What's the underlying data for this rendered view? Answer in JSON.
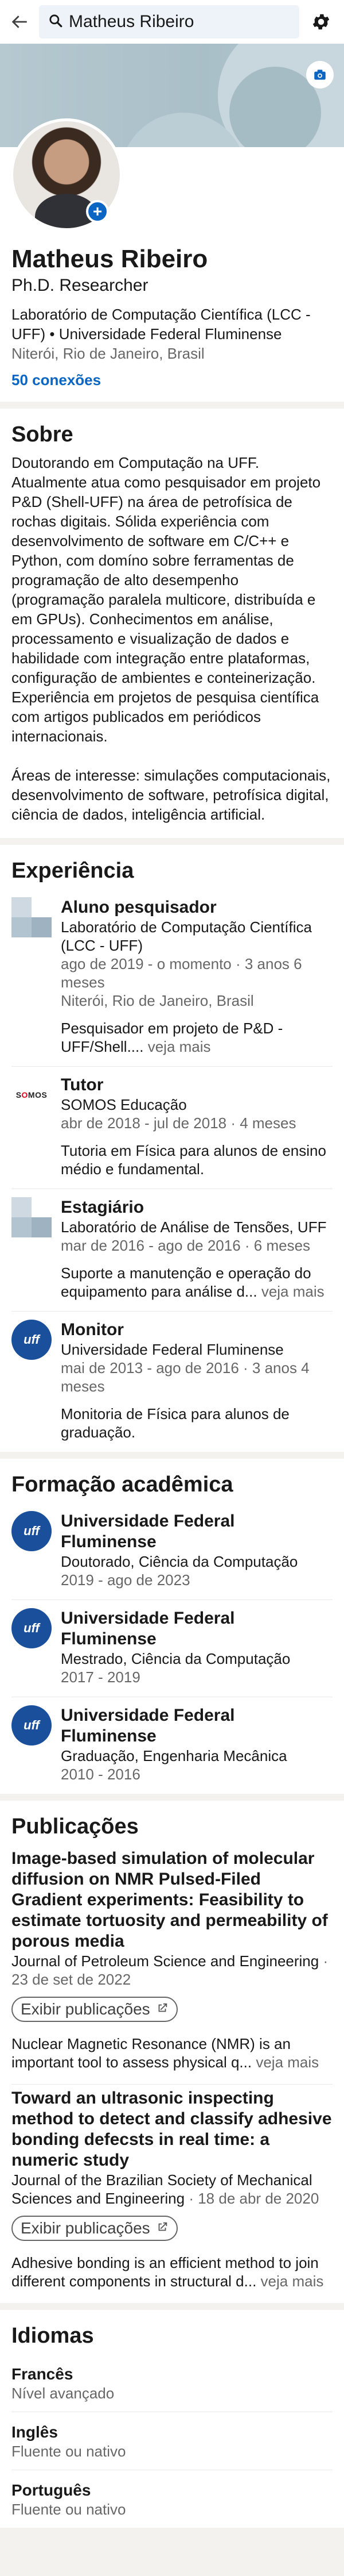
{
  "search": {
    "query": "Matheus Ribeiro"
  },
  "profile": {
    "name": "Matheus Ribeiro",
    "headline": "Ph.D. Researcher",
    "org": "Laboratório de Computação Científica  (LCC - UFF) • Universidade Federal Fluminense",
    "location": "Niterói, Rio de Janeiro, Brasil",
    "connections": "50 conexões"
  },
  "about": {
    "title": "Sobre",
    "paragraph1": "Doutorando em Computação na UFF. Atualmente atua como pesquisador em projeto P&D (Shell-UFF) na área de petrofísica de rochas digitais. Sólida experiência com desenvolvimento de software em C/C++ e Python, com domíno sobre ferramentas de programação de alto desempenho (programação paralela multicore, distribuída e em GPUs). Conhecimentos em análise, processamento e visualização de dados e habilidade com integração entre plataformas, configuração de ambientes e conteinerização. Experiência em projetos de pesquisa científica com artigos publicados em periódicos internacionais.",
    "paragraph2": "Áreas de interesse: simulações computacionais, desenvolvimento de software, petrofísica digital, ciência de dados, inteligência artificial."
  },
  "experience": {
    "title": "Experiência",
    "items": [
      {
        "title": "Aluno pesquisador",
        "org": "Laboratório de Computação Científica (LCC - UFF)",
        "dates": "ago de 2019 - o momento · 3 anos 6 meses",
        "location": "Niterói, Rio de Janeiro, Brasil",
        "desc": "Pesquisador em projeto de P&D - UFF/Shell....",
        "more": "veja mais"
      },
      {
        "title": "Tutor",
        "org": "SOMOS Educação",
        "dates": "abr de 2018 - jul de 2018 · 4 meses",
        "location": "",
        "desc": "Tutoria em Física para alunos de ensino médio e fundamental.",
        "more": ""
      },
      {
        "title": "Estagiário",
        "org": "Laboratório de Análise de Tensões, UFF",
        "dates": "mar de 2016 - ago de 2016 · 6 meses",
        "location": "",
        "desc": "Suporte a manutenção e operação do equipamento para análise d...",
        "more": "veja mais"
      },
      {
        "title": "Monitor",
        "org": "Universidade Federal Fluminense",
        "dates": "mai de 2013 - ago de 2016 · 3 anos 4 meses",
        "location": "",
        "desc": "Monitoria de Física para alunos de graduação.",
        "more": ""
      }
    ]
  },
  "education": {
    "title": "Formação acadêmica",
    "items": [
      {
        "school": "Universidade Federal Fluminense",
        "degree": "Doutorado, Ciência da Computação",
        "dates": "2019 - ago de 2023"
      },
      {
        "school": "Universidade Federal Fluminense",
        "degree": "Mestrado, Ciência da Computação",
        "dates": "2017 - 2019"
      },
      {
        "school": "Universidade Federal Fluminense",
        "degree": "Graduação, Engenharia Mecânica",
        "dates": "2010 - 2016"
      }
    ]
  },
  "publications": {
    "title": "Publicações",
    "button_label": "Exibir publicações",
    "items": [
      {
        "title": "Image-based simulation of molecular diffusion on NMR Pulsed-Filed Gradient experiments: Feasibility to estimate tortuosity and permeability of porous media",
        "journal": "Journal of Petroleum Science and Engineering",
        "date": "· 23 de set de 2022",
        "desc": "Nuclear Magnetic Resonance (NMR) is an important tool to assess physical q...",
        "more": "veja mais"
      },
      {
        "title": "Toward an ultrasonic inspecting method to detect and classify adhesive bonding defecsts in real time: a numeric study",
        "journal": "Journal of the Brazilian Society of Mechanical Sciences and Engineering",
        "date": "· 18 de abr de 2020",
        "desc": "Adhesive bonding is an efficient method to join different components in structural d...",
        "more": "veja mais"
      }
    ]
  },
  "languages": {
    "title": "Idiomas",
    "items": [
      {
        "name": "Francês",
        "level": "Nível avançado"
      },
      {
        "name": "Inglês",
        "level": "Fluente ou nativo"
      },
      {
        "name": "Português",
        "level": "Fluente ou nativo"
      }
    ]
  },
  "logos": {
    "uff": "uff",
    "somos_part1": "S",
    "somos_o": "O",
    "somos_part2": "MOS"
  },
  "colors": {
    "accent": "#0a66c2",
    "uff_blue": "#1a4f9c",
    "page_bg": "#f4f2ee"
  },
  "icons": {
    "back": "arrow-left-icon",
    "search": "search-icon",
    "settings": "gear-icon",
    "cover_edit": "camera-icon",
    "add_photo": "plus-icon",
    "publication_link": "external-link-icon"
  }
}
